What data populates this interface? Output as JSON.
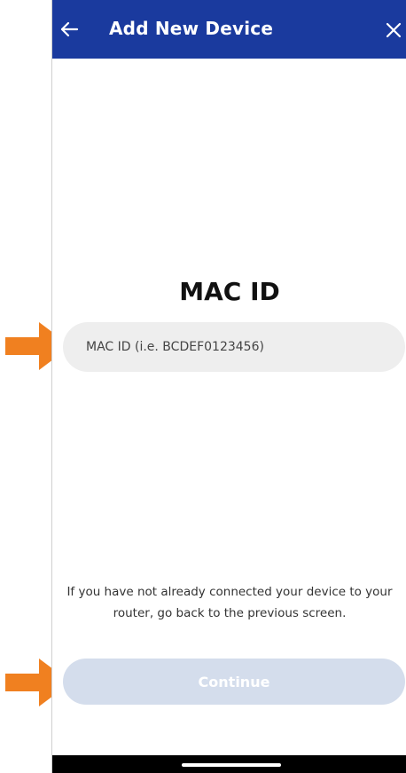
{
  "header": {
    "title": "Add New Device",
    "back_icon": "arrow-left-icon",
    "close_icon": "close-icon",
    "background_color": "#1a3a9e"
  },
  "form": {
    "heading": "MAC ID",
    "mac_input": {
      "placeholder": "MAC ID (i.e. BCDEF0123456)",
      "value": ""
    },
    "helper_text": "If you have not already connected your device to your router, go back to the previous screen.",
    "continue_label": "Continue",
    "continue_state": "disabled"
  },
  "annotations": {
    "arrow_color": "#f08020",
    "arrow_icon": "arrow-right-icon"
  }
}
